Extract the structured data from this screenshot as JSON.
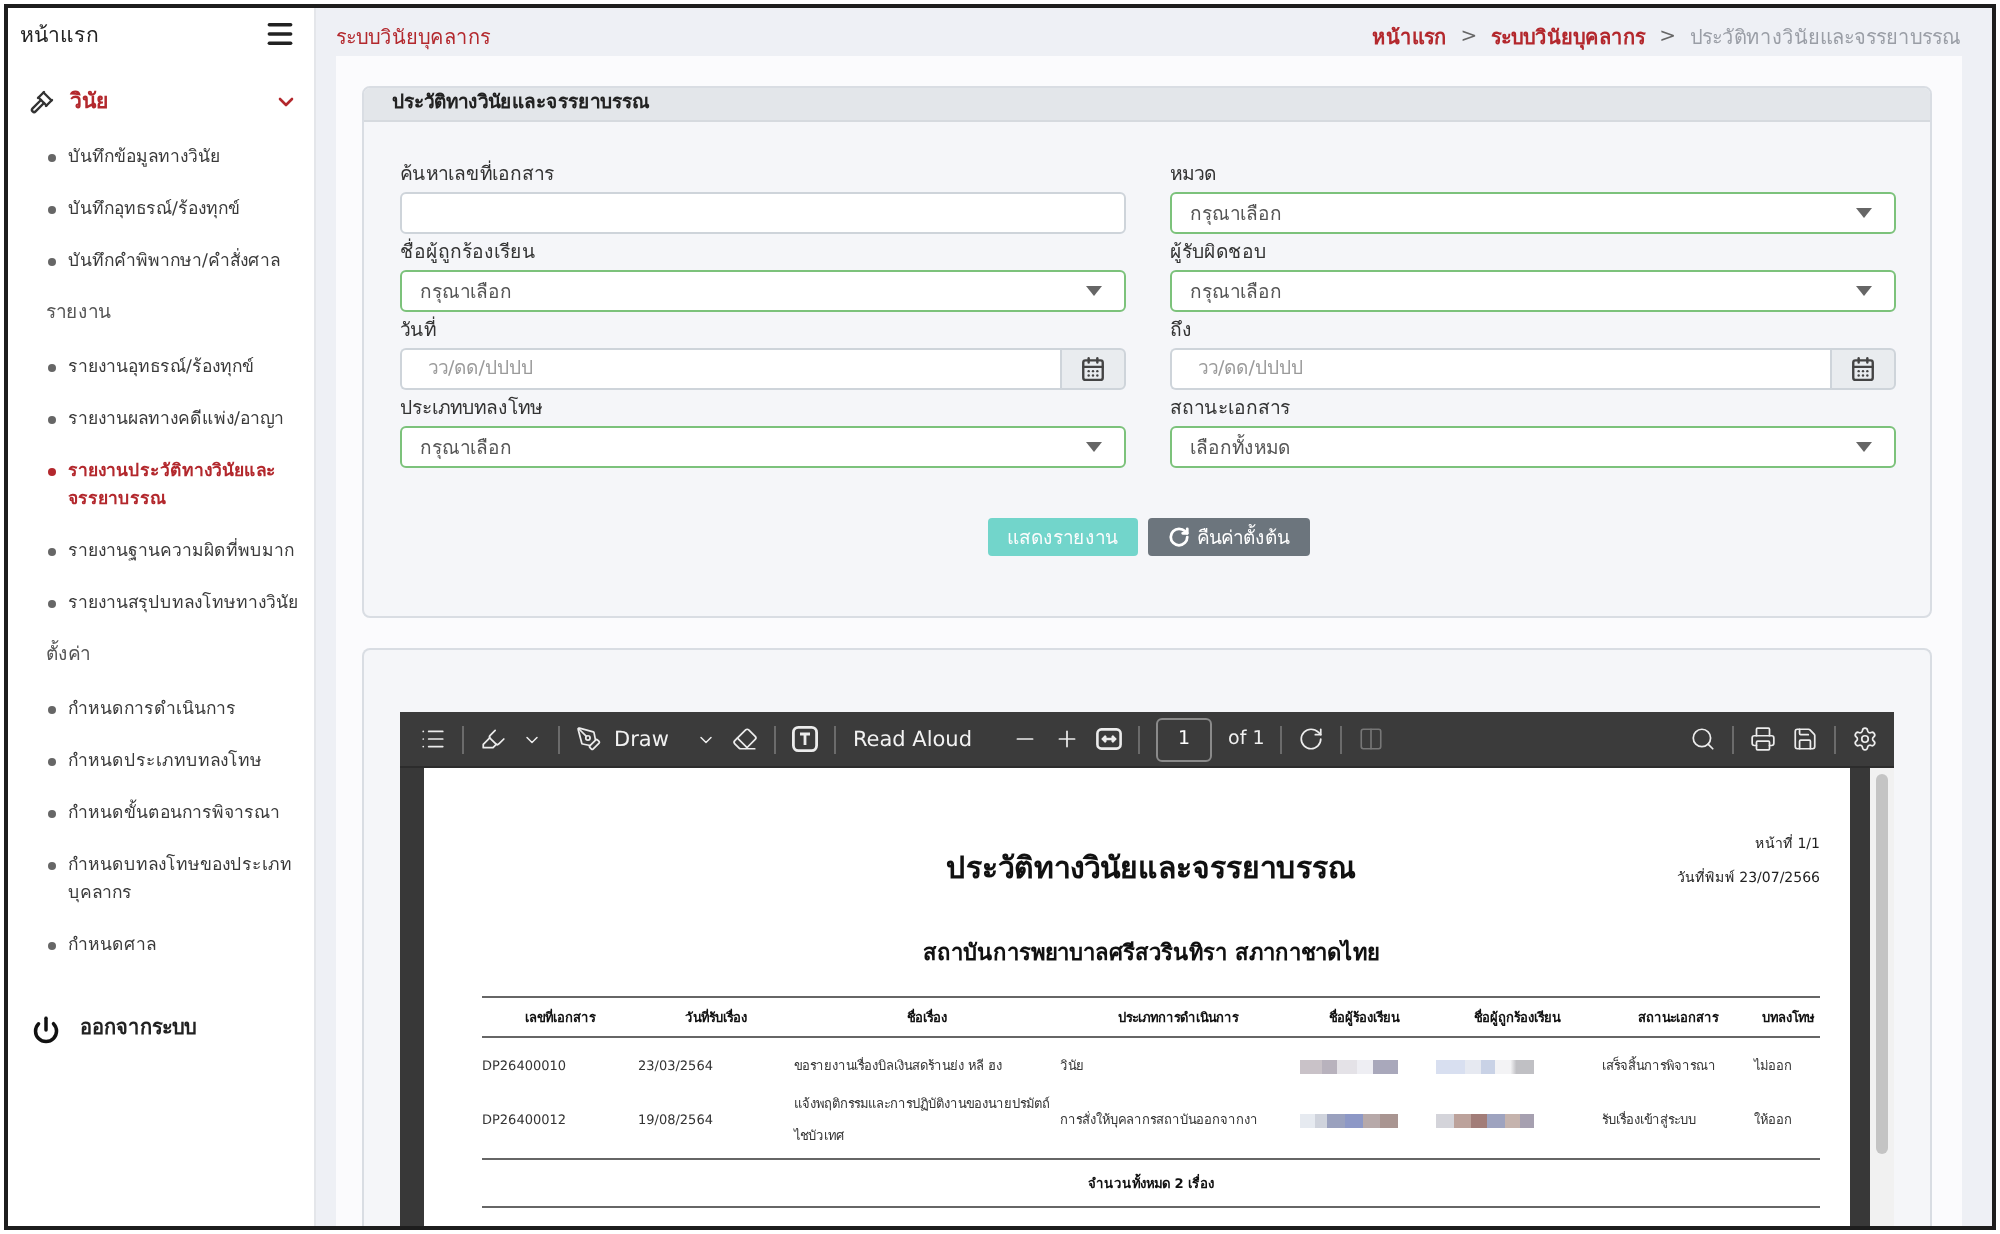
{
  "sidebar": {
    "title": "หน้าแรก",
    "sections": [
      {
        "label": "วินัย",
        "active": true,
        "expanded": true,
        "groups": [
          {
            "items": [
              {
                "label": "บันทึกข้อมูลทางวินัย",
                "selected": false
              },
              {
                "label": "บันทึกอุทธรณ์/ร้องทุกข์",
                "selected": false
              },
              {
                "label": "บันทึกคำพิพากษา/คำสั่งศาล",
                "selected": false
              }
            ]
          },
          {
            "heading": "รายงาน",
            "items": [
              {
                "label": "รายงานอุทธรณ์/ร้องทุกข์",
                "selected": false
              },
              {
                "label": "รายงานผลทางคดีแพ่ง/อาญา",
                "selected": false
              },
              {
                "label": "รายงานประวัติทางวินัยและจรรยาบรรณ",
                "selected": true
              },
              {
                "label": "รายงานฐานความผิดที่พบมาก",
                "selected": false
              },
              {
                "label": "รายงานสรุปบทลงโทษทางวินัย",
                "selected": false
              }
            ]
          },
          {
            "heading": "ตั้งค่า",
            "items": [
              {
                "label": "กำหนดการดำเนินการ",
                "selected": false
              },
              {
                "label": "กำหนดประเภทบทลงโทษ",
                "selected": false
              },
              {
                "label": "กำหนดขั้นตอนการพิจารณา",
                "selected": false
              },
              {
                "label": "กำหนดบทลงโทษของประเภทบุคลากร",
                "selected": false
              },
              {
                "label": "กำหนดศาล",
                "selected": false
              }
            ]
          }
        ]
      }
    ],
    "logout": {
      "label": "ออกจากระบบ"
    }
  },
  "topbar": {
    "title": "ระบบวินัยบุคลากร",
    "breadcrumb": [
      {
        "label": "หน้าแรก",
        "kind": "link"
      },
      {
        "label": "ระบบวินัยบุคลากร",
        "kind": "link",
        "separator": ">"
      },
      {
        "label": "ประวัติทางวินัยและจรรยาบรรณ",
        "kind": "current",
        "separator": ">"
      }
    ]
  },
  "filter_panel": {
    "title": "ประวัติทางวินัยและจรรยาบรรณ",
    "fields": [
      {
        "kind": "text",
        "label": "ค้นหาเลขที่เอกสาร",
        "valid": false
      },
      {
        "kind": "select",
        "label": "หมวด",
        "value": "กรุณาเลือก",
        "valid": true
      },
      {
        "kind": "select",
        "label": "ชื่อผู้ถูกร้องเรียน",
        "value": "กรุณาเลือก",
        "valid": true
      },
      {
        "kind": "select",
        "label": "ผู้รับผิดชอบ",
        "value": "กรุณาเลือก",
        "valid": true
      },
      {
        "kind": "date",
        "label": "วันที่",
        "placeholder": "วว/ดด/ปปปป",
        "valid": false
      },
      {
        "kind": "date",
        "label": "ถึง",
        "placeholder": "วว/ดด/ปปปป",
        "valid": false
      },
      {
        "kind": "select",
        "label": "ประเภทบทลงโทษ",
        "value": "กรุณาเลือก",
        "valid": true
      },
      {
        "kind": "select",
        "label": "สถานะเอกสาร",
        "value": "เลือกทั้งหมด",
        "valid": true
      }
    ],
    "buttons": [
      {
        "kind": "primary",
        "label": "แสดงรายงาน",
        "disabled": true
      },
      {
        "kind": "reset",
        "label": "คืนค่าตั้งต้น",
        "disabled": false
      }
    ]
  },
  "report_viewer": {
    "toolbar": {
      "draw_label": "Draw",
      "read_aloud_label": "Read Aloud",
      "page": "1",
      "page_total": "of 1",
      "page_view_disabled": true
    },
    "document": {
      "page_info": "หน้าที่ 1/1",
      "print_date": "วันที่พิมพ์ 23/07/2566",
      "title": "ประวัติทางวินัยและจรรยาบรรณ",
      "subtitle": "สถาบันการพยาบาลศรีสวรินทิรา สภากาชาดไทย",
      "table": {
        "columns": [
          "เลขที่เอกสาร",
          "วันที่รับเรื่อง",
          "ชื่อเรื่อง",
          "ประเภทการดำเนินการ",
          "ชื่อผู้ร้องเรียน",
          "ชื่อผู้ถูกร้องเรียน",
          "สถานะเอกสาร",
          "บทลงโทษ"
        ],
        "rows": [
          {
            "cells": [
              "DP26400010",
              "23/03/2564",
              "ขอรายงานเรื่องบิลเงินสดร้านย่ง หลี ฮง",
              "วินัย",
              {
                "redacted": true
              },
              {
                "redacted": true
              },
              "เสร็จสิ้นการพิจารณา",
              "ไม่ออก"
            ]
          },
          {
            "cells": [
              "DP26400012",
              "19/08/2564",
              "แจ้งพฤติกรรมและการปฏิบัติงานของนายปรมัตถ์ ไชบัวเทศ",
              "การสั่งให้บุคลากรสถาบันออกจากงา",
              {
                "redacted": true
              },
              {
                "redacted": true
              },
              "รับเรื่องเข้าสู่ระบบ",
              "ให้ออก"
            ]
          }
        ],
        "footer": "จำนวนทั้งหมด 2 เรื่อง"
      }
    }
  }
}
